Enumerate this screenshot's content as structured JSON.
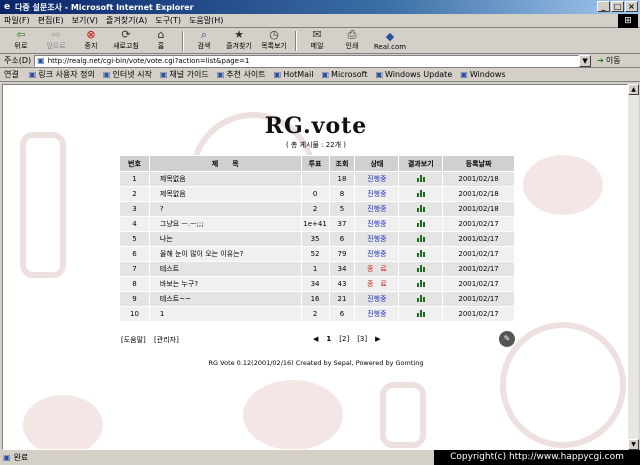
{
  "window": {
    "title": "다중 설문조사 - Microsoft Internet Explorer",
    "min": "_",
    "max": "□",
    "close": "×"
  },
  "menu": [
    "파일(F)",
    "편집(E)",
    "보기(V)",
    "즐겨찾기(A)",
    "도구(T)",
    "도움말(H)"
  ],
  "toolbar": [
    {
      "label": "뒤로",
      "icon": "back-arrow-icon",
      "glyph": "⇦"
    },
    {
      "label": "앞으로",
      "icon": "forward-arrow-icon",
      "glyph": "⇨"
    },
    {
      "label": "중지",
      "icon": "stop-icon",
      "glyph": "⊗"
    },
    {
      "label": "새로고침",
      "icon": "refresh-icon",
      "glyph": "⟳"
    },
    {
      "label": "홈",
      "icon": "home-icon",
      "glyph": "⌂"
    },
    {
      "label": "검색",
      "icon": "search-icon",
      "glyph": "⌕"
    },
    {
      "label": "즐겨찾기",
      "icon": "favorites-icon",
      "glyph": "★"
    },
    {
      "label": "목록보기",
      "icon": "history-icon",
      "glyph": "◷"
    },
    {
      "label": "메일",
      "icon": "mail-icon",
      "glyph": "✉"
    },
    {
      "label": "인쇄",
      "icon": "print-icon",
      "glyph": "⎙"
    },
    {
      "label": "Real.com",
      "icon": "realcom-icon",
      "glyph": "◆"
    }
  ],
  "address": {
    "label": "주소(D)",
    "url": "http://realg.net/cgi-bin/vote/vote.cgi?action=list&page=1",
    "go": "이동"
  },
  "links": {
    "label": "연결",
    "items": [
      "링크 사용자 정의",
      "인터넷 시작",
      "채널 가이드",
      "추천 사이트",
      "HotMail",
      "Microsoft",
      "Windows Update",
      "Windows"
    ]
  },
  "page": {
    "logo": "RG.vote",
    "total": "( 총 게시물 : 22개 )",
    "headers": [
      "번호",
      "제　　목",
      "투표",
      "조회",
      "상태",
      "결과보기",
      "등록날짜"
    ],
    "rows": [
      {
        "no": "1",
        "title": "제목없음",
        "votes": "",
        "views": "18",
        "status": "진행중",
        "status_type": "open",
        "date": "2001/02/18"
      },
      {
        "no": "2",
        "title": "제목없음",
        "votes": "0",
        "views": "8",
        "status": "진행중",
        "status_type": "open",
        "date": "2001/02/18"
      },
      {
        "no": "3",
        "title": "?",
        "votes": "2",
        "views": "5",
        "status": "진행중",
        "status_type": "open",
        "date": "2001/02/18"
      },
      {
        "no": "4",
        "title": "그냥요 ㅡ.ㅡ;;;",
        "votes": "1e+41",
        "views": "37",
        "status": "진행중",
        "status_type": "open",
        "date": "2001/02/17"
      },
      {
        "no": "5",
        "title": "나는",
        "votes": "35",
        "views": "6",
        "status": "진행중",
        "status_type": "open",
        "date": "2001/02/17"
      },
      {
        "no": "6",
        "title": "올해 눈이 많이 오는 이유는?",
        "votes": "52",
        "views": "79",
        "status": "진행중",
        "status_type": "open",
        "date": "2001/02/17"
      },
      {
        "no": "7",
        "title": "테스트",
        "votes": "1",
        "views": "34",
        "status": "종　료",
        "status_type": "closed",
        "date": "2001/02/17"
      },
      {
        "no": "8",
        "title": "바보는 누구?",
        "votes": "34",
        "views": "43",
        "status": "종　료",
        "status_type": "closed",
        "date": "2001/02/17"
      },
      {
        "no": "9",
        "title": "테스트~~",
        "votes": "16",
        "views": "21",
        "status": "진행중",
        "status_type": "open",
        "date": "2001/02/17"
      },
      {
        "no": "10",
        "title": "1",
        "votes": "2",
        "views": "6",
        "status": "진행중",
        "status_type": "open",
        "date": "2001/02/17"
      }
    ],
    "bottom_links": [
      "[도움말]",
      "[관리자]"
    ],
    "pager": {
      "prev": "◀",
      "pages": [
        "1",
        "[2]",
        "[3]"
      ],
      "next": "▶"
    },
    "credit": "RG Vote 0.12(2001/02/16) Created by Sepal, Powered by Gomting"
  },
  "status": {
    "text": "완료"
  },
  "watermark": "Copyright(c) http://www.happycgi.com",
  "colors": {
    "open": "#2030c0",
    "closed": "#d02020",
    "header_bg": "#d0d0d0",
    "titlebar": "#0a246a"
  }
}
